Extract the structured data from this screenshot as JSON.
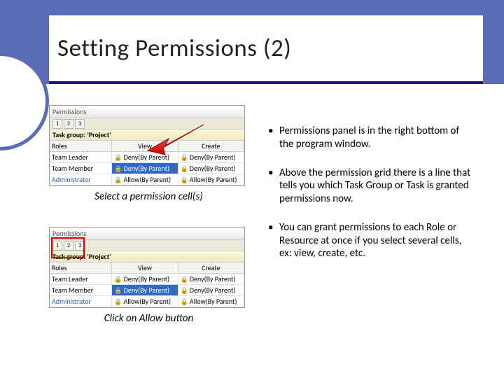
{
  "title": "Setting Permissions (2)",
  "screenshot": {
    "panelTitle": "Permissions",
    "groupLabel": "Task group: 'Project'",
    "headers": {
      "roles": "Roles",
      "view": "View",
      "create": "Create"
    },
    "rows": [
      {
        "role": "Team Leader",
        "view": "Deny(By Parent)",
        "create": "Deny(By Parent)"
      },
      {
        "role": "Team Member",
        "view": "Deny(By Parent)",
        "create": "Deny(By Parent)"
      },
      {
        "role": "Administrator",
        "view": "Allow(By Parent)",
        "create": "Allow(By Parent)"
      }
    ],
    "toolbarIcons": [
      "1",
      "2",
      "3"
    ]
  },
  "caption1": "Select a permission cell(s)",
  "caption2": "Click on Allow button",
  "bullets": [
    "Permissions panel is in the right bottom of the program window.",
    "Above the permission grid there is a line that tells you which Task Group or Task is granted permissions now.",
    "You can grant permissions to each Role or Resource at once if you select several cells, ex: view, create, etc."
  ]
}
